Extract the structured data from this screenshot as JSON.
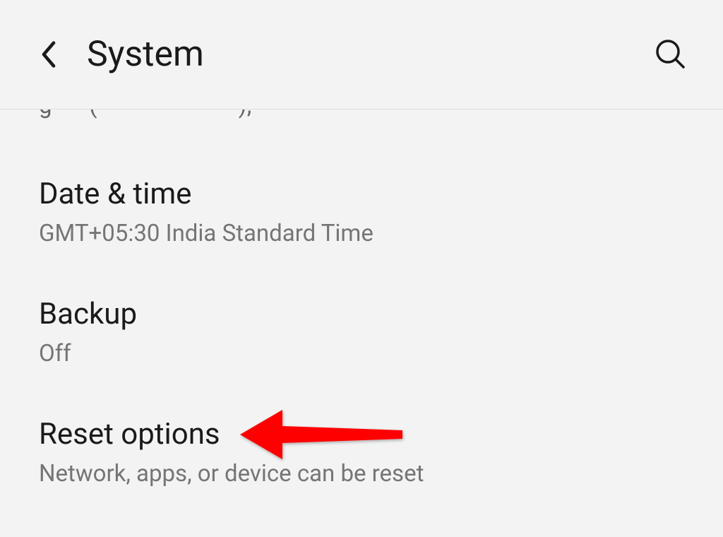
{
  "header": {
    "title": "System"
  },
  "settings": [
    {
      "title": "Date & time",
      "subtitle": "GMT+05:30 India Standard Time"
    },
    {
      "title": "Backup",
      "subtitle": "Off"
    },
    {
      "title": "Reset options",
      "subtitle": "Network, apps, or device can be reset"
    }
  ]
}
